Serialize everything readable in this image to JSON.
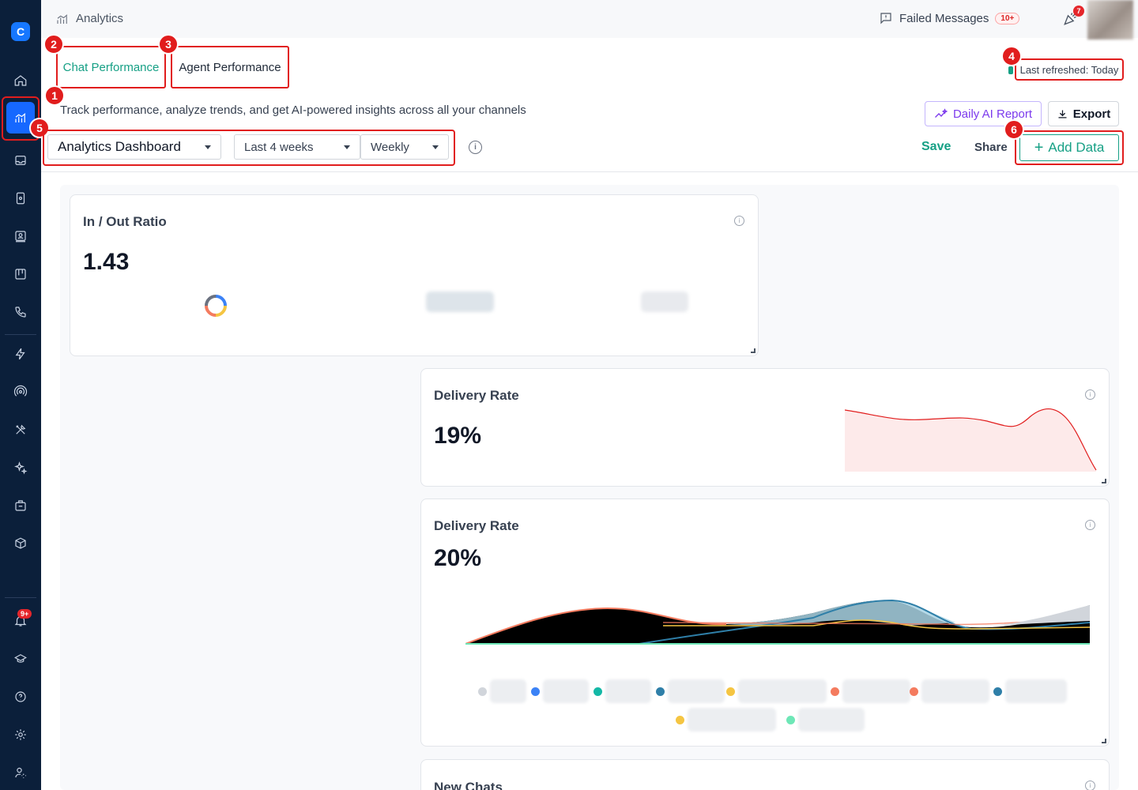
{
  "app": {
    "logo_letter": "C"
  },
  "topbar": {
    "title": "Analytics",
    "failed_messages_label": "Failed Messages",
    "failed_messages_badge": "10+",
    "notifications_badge": "7"
  },
  "sidebar": {
    "notification_badge": "9+"
  },
  "tabs": [
    {
      "label": "Chat Performance",
      "active": true
    },
    {
      "label": "Agent Performance",
      "active": false
    }
  ],
  "subtitle": "Track performance, analyze trends, and get AI-powered insights across all your channels",
  "last_refreshed": "Last refreshed: Today",
  "toolbar": {
    "daily_ai_report": "Daily AI Report",
    "export": "Export",
    "dashboard_select": "Analytics Dashboard",
    "range_select": "Last 4 weeks",
    "frequency_select": "Weekly",
    "save": "Save",
    "share": "Share",
    "add_data": "Add Data"
  },
  "markers": [
    "1",
    "2",
    "3",
    "4",
    "5",
    "6"
  ],
  "cards": [
    {
      "title": "In / Out Ratio",
      "value": "1.43"
    },
    {
      "title": "Delivery Rate",
      "value": "19%"
    },
    {
      "title": "Delivery Rate",
      "value": "20%"
    },
    {
      "title": "New Chats",
      "value": ""
    }
  ],
  "legend_colors": [
    "#d1d5db",
    "#3b82f6",
    "#14b8a6",
    "#2f7fa8",
    "#f5c542",
    "#f47b5f",
    "#f47b5f",
    "#2f7fa8",
    "#f5c542",
    "#6ee7b7"
  ],
  "colors": {
    "accent": "#16a085",
    "brand": "#1668ff",
    "annotation": "#e11d1d",
    "ai": "#7c3aed"
  }
}
